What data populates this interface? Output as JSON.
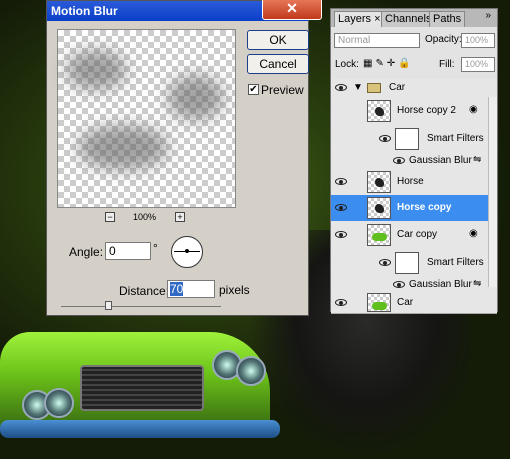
{
  "dialog": {
    "title": "Motion Blur",
    "close": "✕",
    "ok": "OK",
    "cancel": "Cancel",
    "preview_label": "Preview",
    "preview_checked": true,
    "zoom": "100%",
    "zoom_out": "−",
    "zoom_in": "+",
    "angle_label": "Angle:",
    "angle_value": "0",
    "angle_unit": "°",
    "distance_label": "Distance:",
    "distance_value": "70",
    "distance_unit": "pixels",
    "distance_slider_fraction": 0.3
  },
  "panel": {
    "tabs": [
      "Layers ×",
      "Channels",
      "Paths"
    ],
    "blend_mode": "Normal",
    "opacity_label": "Opacity:",
    "opacity_value": "100%",
    "lock_label": "Lock:",
    "fill_label": "Fill:",
    "fill_value": "100%",
    "layers": [
      {
        "name": "Car",
        "kind": "group"
      },
      {
        "name": "Horse copy 2",
        "kind": "smart"
      },
      {
        "name": "Smart Filters",
        "kind": "filters"
      },
      {
        "name": "Gaussian Blur",
        "kind": "filter"
      },
      {
        "name": "Horse",
        "kind": "layer"
      },
      {
        "name": "Horse copy",
        "kind": "layer",
        "selected": true
      },
      {
        "name": "Car copy",
        "kind": "smart"
      },
      {
        "name": "Smart Filters",
        "kind": "filters"
      },
      {
        "name": "Gaussian Blur",
        "kind": "filter"
      },
      {
        "name": "Car",
        "kind": "layer"
      }
    ]
  },
  "colors": {
    "titlebar": "#0a3fc9",
    "selected_layer": "#3b8df0",
    "car_green": "#6cc21a"
  }
}
